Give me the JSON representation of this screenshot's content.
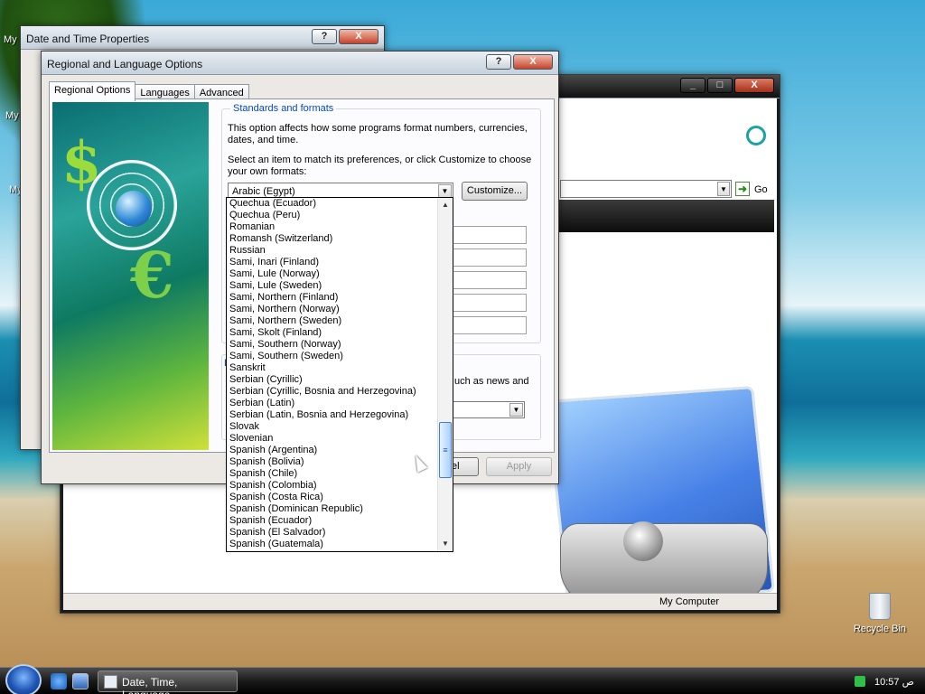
{
  "desktop": {
    "icons": [
      {
        "label": "My"
      },
      {
        "label": "My"
      },
      {
        "label": "My"
      },
      {
        "label": "Recycle Bin"
      }
    ]
  },
  "windows": {
    "datetime": {
      "title": "Date and Time Properties",
      "help": "?",
      "close": "X"
    },
    "explorer": {
      "minimize": "_",
      "maximize": "□",
      "close": "X",
      "address_dropdown": "▼",
      "go_arrow": "➜",
      "go_label": "Go",
      "status_text": "My Computer"
    },
    "regional": {
      "title": "Regional and Language Options",
      "help": "?",
      "close": "X",
      "tabs": [
        "Regional Options",
        "Languages",
        "Advanced"
      ],
      "standards_title": "Standards and formats",
      "desc1": "This option affects how some programs format numbers, currencies, dates, and time.",
      "desc2": "Select an item to match its preferences, or click Customize to choose your own formats:",
      "selected_format": "Arabic (Egypt)",
      "combo_arrow": "▼",
      "customize_label": "Customize...",
      "location_letter": "L",
      "location_text": "uch as news and",
      "cancel_partial": "el",
      "apply_label": "Apply"
    }
  },
  "dropdown": {
    "scroll_up": "▲",
    "scroll_down": "▼",
    "thumb_grip": "≡",
    "items": [
      "Quechua (Ecuador)",
      "Quechua (Peru)",
      "Romanian",
      "Romansh (Switzerland)",
      "Russian",
      "Sami, Inari (Finland)",
      "Sami, Lule (Norway)",
      "Sami, Lule (Sweden)",
      "Sami, Northern (Finland)",
      "Sami, Northern (Norway)",
      "Sami, Northern (Sweden)",
      "Sami, Skolt (Finland)",
      "Sami, Southern (Norway)",
      "Sami, Southern (Sweden)",
      "Sanskrit",
      "Serbian (Cyrillic)",
      "Serbian (Cyrillic, Bosnia and Herzegovina)",
      "Serbian (Latin)",
      "Serbian (Latin, Bosnia and Herzegovina)",
      "Slovak",
      "Slovenian",
      "Spanish (Argentina)",
      "Spanish (Bolivia)",
      "Spanish (Chile)",
      "Spanish (Colombia)",
      "Spanish (Costa Rica)",
      "Spanish (Dominican Republic)",
      "Spanish (Ecuador)",
      "Spanish (El Salvador)",
      "Spanish (Guatemala)"
    ]
  },
  "taskbar": {
    "task_label": "Date, Time, Language...",
    "clock": "10:57 ص"
  }
}
